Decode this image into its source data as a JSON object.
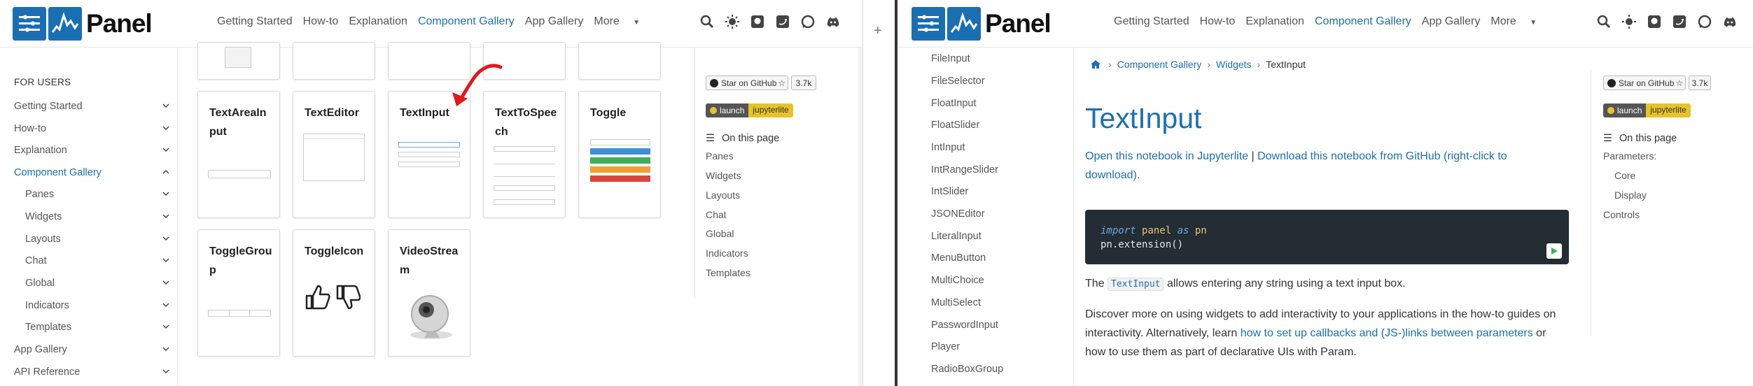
{
  "app": {
    "logo_text": "Panel",
    "nav": [
      "Getting Started",
      "How-to",
      "Explanation",
      "Component Gallery",
      "App Gallery",
      "More"
    ]
  },
  "left": {
    "sidebar": {
      "section": "FOR USERS",
      "items": [
        {
          "label": "Getting Started"
        },
        {
          "label": "How-to"
        },
        {
          "label": "Explanation"
        },
        {
          "label": "Component Gallery"
        },
        {
          "label": "Panes"
        },
        {
          "label": "Widgets"
        },
        {
          "label": "Layouts"
        },
        {
          "label": "Chat"
        },
        {
          "label": "Global"
        },
        {
          "label": "Indicators"
        },
        {
          "label": "Templates"
        },
        {
          "label": "App Gallery"
        },
        {
          "label": "API Reference"
        }
      ]
    },
    "cards": [
      {
        "title": "TextAreaInput"
      },
      {
        "title": "TextEditor"
      },
      {
        "title": "TextInput"
      },
      {
        "title": "TextToSpeech"
      },
      {
        "title": "Toggle"
      },
      {
        "title": "ToggleGroup"
      },
      {
        "title": "ToggleIcon"
      },
      {
        "title": "VideoStream"
      }
    ],
    "github_badge": "Star on GitHub",
    "github_count": "3.7k",
    "launch": "launch",
    "jupyterlite": "jupyterlite",
    "toc_title": "On this page",
    "toc": [
      "Panes",
      "Widgets",
      "Layouts",
      "Chat",
      "Global",
      "Indicators",
      "Templates"
    ]
  },
  "right": {
    "sidebar_items": [
      "FileInput",
      "FileSelector",
      "FloatInput",
      "FloatSlider",
      "IntInput",
      "IntRangeSlider",
      "IntSlider",
      "JSONEditor",
      "LiteralInput",
      "MenuButton",
      "MultiChoice",
      "MultiSelect",
      "PasswordInput",
      "Player",
      "RadioBoxGroup"
    ],
    "breadcrumb": [
      "Component Gallery",
      "Widgets",
      "TextInput"
    ],
    "title": "TextInput",
    "notebook_link1": "Open this notebook in Jupyterlite",
    "notebook_sep": " | ",
    "notebook_link2": "Download this notebook from GitHub (right-click to download).",
    "code_line1_kw": "import",
    "code_line1_mod": "panel",
    "code_line1_as": "as",
    "code_line1_alias": "pn",
    "code_line2": "pn.extension()",
    "desc_prefix": "The",
    "desc_code": "TextInput",
    "desc_suffix": "allows entering any string using a text input box.",
    "discover_prefix": "Discover more on using widgets to add interactivity to your applications in the how-to guides on interactivity. Alternatively, learn",
    "discover_link": "how to set up callbacks and (JS-)links between parameters",
    "discover_suffix": "or how to use them as part of declarative UIs with Param.",
    "github_badge": "Star on GitHub",
    "github_count": "3.7k",
    "launch": "launch",
    "jupyterlite": "jupyterlite",
    "toc_title": "On this page",
    "toc": [
      "Parameters:",
      "Core",
      "Display",
      "Controls"
    ]
  },
  "colors": {
    "brand": "#1a6fb3",
    "link": "#1d6fb0",
    "annotation_arrow": "#e0191c"
  }
}
